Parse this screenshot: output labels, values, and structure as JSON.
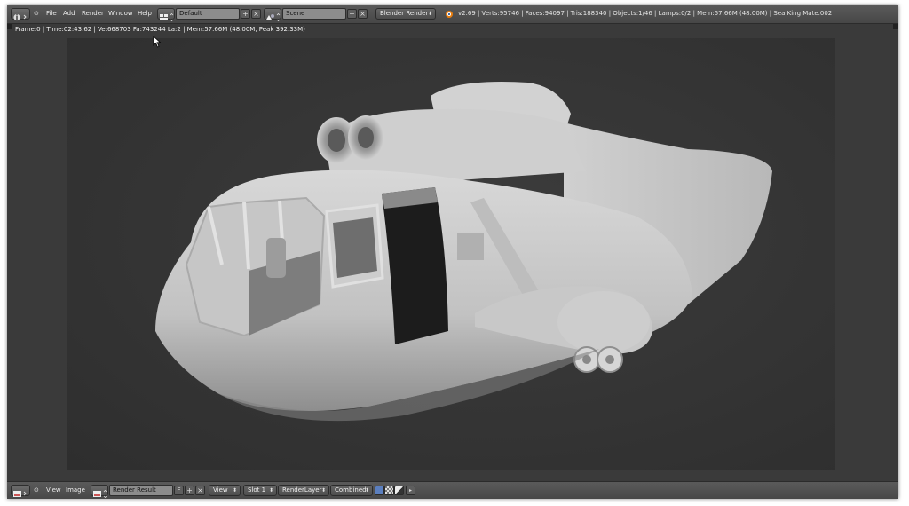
{
  "header": {
    "menus": [
      "File",
      "Add",
      "Render",
      "Window",
      "Help"
    ],
    "screen_layout": "Default",
    "scene": "Scene",
    "render_engine": "Blender Render",
    "stats": "v2.69 | Verts:95746 | Faces:94097 | Tris:188340 | Objects:1/46 | Lamps:0/2 | Mem:57.66M (48.00M) | Sea King Mate.002"
  },
  "editor": {
    "render_info": "Frame:0 | Time:02:43.62 | Ve:668703 Fa:743244 La:2 | Mem:57.66M (48.00M, Peak 392.33M)"
  },
  "footer": {
    "menus": [
      "View",
      "Image"
    ],
    "image_name": "Render Result",
    "fake_user": "F",
    "view_label": "View",
    "slot": "Slot 1",
    "render_layer": "RenderLayer",
    "pass": "Combined"
  },
  "colors": {
    "background": "#393939",
    "header": "#4f4f4f",
    "render_bg": "#2f2f2f",
    "model": "#c8c8c8",
    "accent_blue": "#5b7fbf"
  }
}
